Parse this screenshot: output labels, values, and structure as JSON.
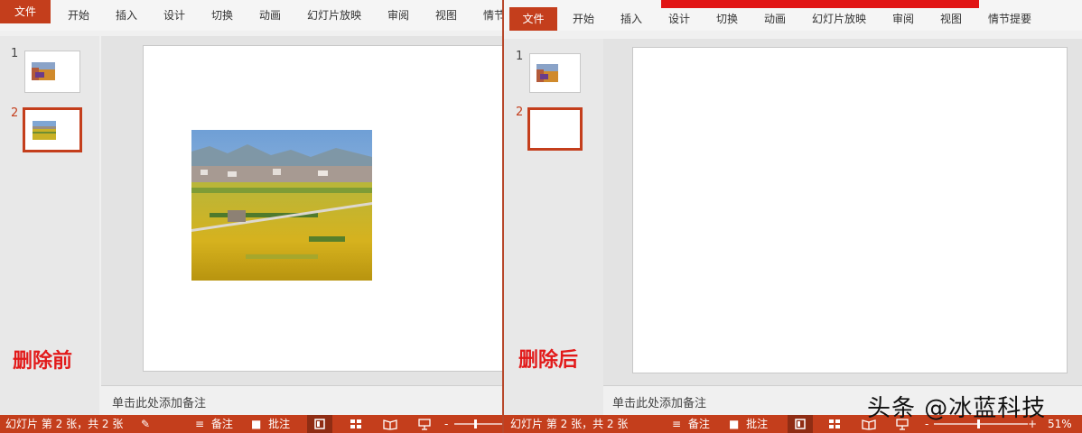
{
  "left": {
    "ribbon_tabs": [
      "文件",
      "开始",
      "插入",
      "设计",
      "切换",
      "动画",
      "幻灯片放映",
      "审阅",
      "视图",
      "情节"
    ],
    "thumbnails": [
      {
        "number": "1"
      },
      {
        "number": "2"
      }
    ],
    "notes_placeholder": "单击此处添加备注",
    "caption": "删除前",
    "status": {
      "slide_info": "幻灯片 第 2 张，共 2 张",
      "notes_label": "备注",
      "comments_label": "批注"
    }
  },
  "right": {
    "ribbon_tabs": [
      "文件",
      "开始",
      "插入",
      "设计",
      "切换",
      "动画",
      "幻灯片放映",
      "审阅",
      "视图",
      "情节提要"
    ],
    "thumbnails": [
      {
        "number": "1"
      },
      {
        "number": "2"
      }
    ],
    "notes_placeholder": "单击此处添加备注",
    "caption": "删除后",
    "status": {
      "slide_info": "幻灯片 第 2 张，共 2 张",
      "notes_label": "备注",
      "comments_label": "批注",
      "zoom": "51%"
    }
  },
  "watermark": "头条 @冰蓝科技",
  "colors": {
    "accent": "#c43e1c",
    "caption": "#e21a1a"
  },
  "icons": [
    "notes-icon",
    "comments-icon",
    "normal-view-icon",
    "slide-sorter-icon",
    "reading-view-icon",
    "slideshow-icon",
    "sidebar-toggle-icon"
  ]
}
